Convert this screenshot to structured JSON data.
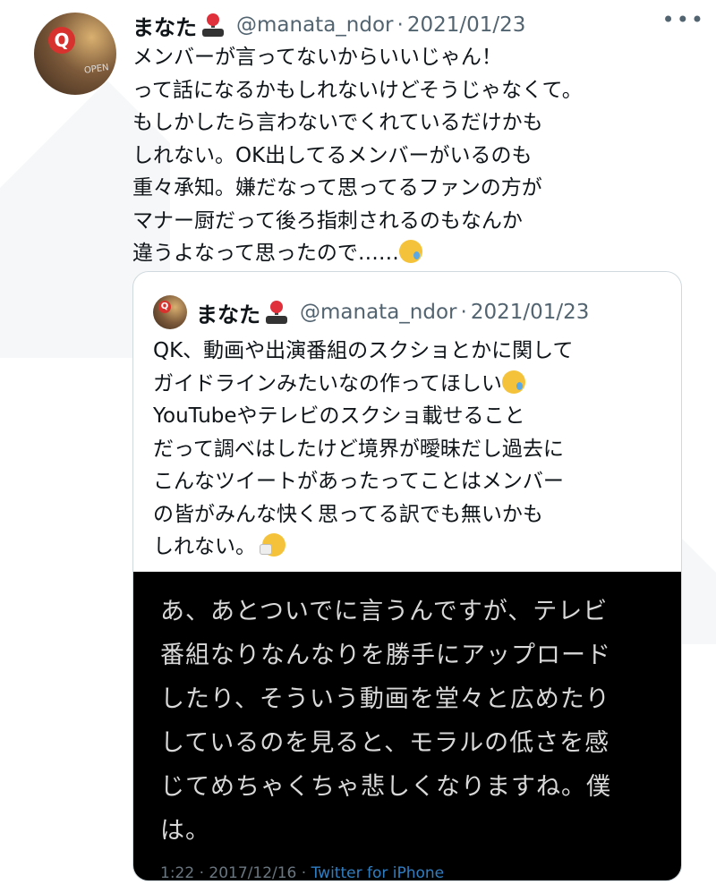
{
  "tweet": {
    "author_name": "まなた",
    "author_badge_icon": "joystick-icon",
    "handle": "@manata_ndor",
    "date_sep": "·",
    "date": "2021/01/23",
    "more_label": "•••",
    "text": "メンバーが言ってないからいいじゃん！\nって話になるかもしれないけどそうじゃなくて。\nもしかしたら言わないでくれているだけかも\nしれない。OK出してるメンバーがいるのも\n重々承知。嫌だなって思ってるファンの方が\nマナー厨だって後ろ指刺されるのもなんか\n違うよなって思ったので……",
    "text_emoji": "face-holding-back-tears-icon"
  },
  "avatar": {
    "logo_letter": "Q",
    "sign_text": "OPEN"
  },
  "quoted_tweet": {
    "author_name": "まなた",
    "author_badge_icon": "joystick-icon",
    "handle": "@manata_ndor",
    "date_sep": "·",
    "date": "2021/01/23",
    "text_part1": "QK、動画や出演番組のスクショとかに関して\nガイドラインみたいなの作ってほしい",
    "text_part2": "\nYouTubeやテレビのスクショ載せること\nだって調べはしたけど境界が曖昧だし過去に\nこんなツイートがあったってことはメンバー\nの皆がみんな快く思ってる訳でも無いかも\nしれない。",
    "emoji_1": "face-holding-back-tears-icon",
    "emoji_2": "sneezing-face-icon",
    "image": {
      "text": "あ、あとついでに言うんですが、テレビ\n番組なりなんなりを勝手にアップロード\nしたり、そういう動画を堂々と広めたり\nしているのを見ると、モラルの低さを感\nじてめちゃくちゃ悲しくなりますね。僕\nは。",
      "footer_time_date": "1:22 · 2017/12/16 · ",
      "footer_app": "Twitter for iPhone"
    }
  },
  "colors": {
    "text": "#0f1419",
    "secondary": "#536471",
    "border": "#cfd9de",
    "image_bg": "#000000",
    "link": "#2f7ec2"
  }
}
